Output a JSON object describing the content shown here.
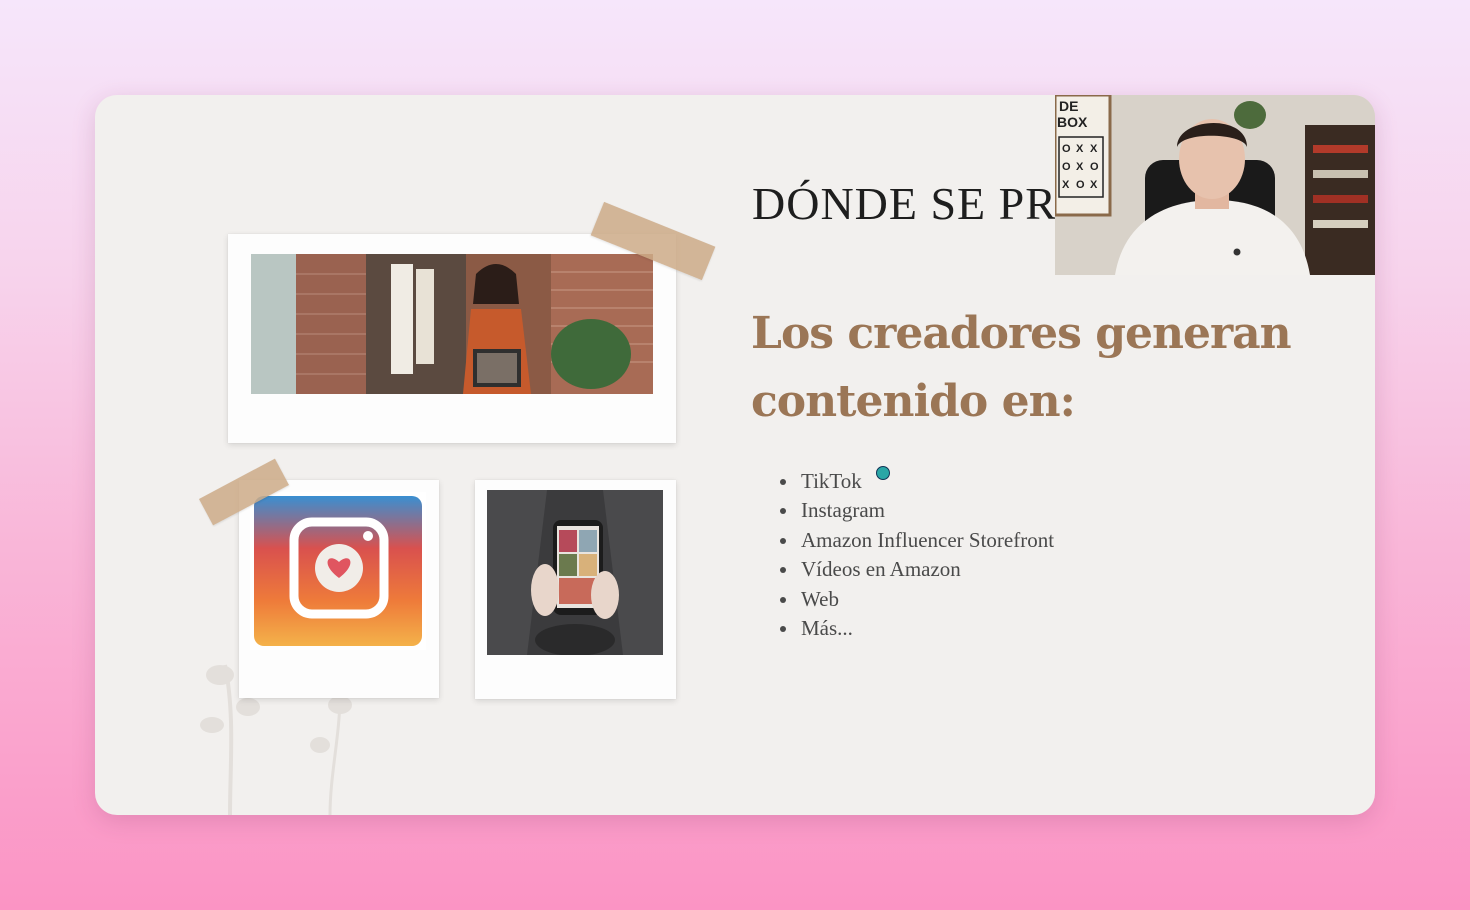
{
  "slide": {
    "title": "DÓNDE SE PR",
    "subtitle_line1": "Los creadores generan",
    "subtitle_line2": "contenido en:",
    "bullets": [
      "TikTok",
      "Instagram",
      "Amazon Influencer Storefront",
      "Vídeos en Amazon",
      "Web",
      "Más..."
    ]
  },
  "webcam": {
    "sign_lines": [
      "DE",
      "BOX"
    ],
    "tic_tac_toe": [
      "O",
      "X",
      "X",
      "O",
      "X",
      "O",
      "X",
      "O",
      "X"
    ]
  },
  "colors": {
    "accent": "#9b7656",
    "background_top": "#f6e6fb",
    "background_bottom": "#fb94c4",
    "slide": "#f2f0ee"
  }
}
